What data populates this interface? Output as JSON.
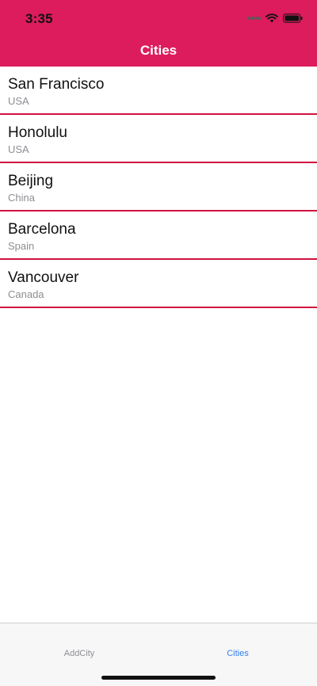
{
  "status_bar": {
    "time": "3:35",
    "icons": [
      "signal-dots-icon",
      "wifi-icon",
      "battery-icon"
    ]
  },
  "nav": {
    "title": "Cities"
  },
  "colors": {
    "header_bg": "#dc1c5c",
    "separator": "#d0133f",
    "active_tab": "#2f80ed",
    "inactive_tab": "#8e8e93"
  },
  "cities": [
    {
      "name": "San Francisco",
      "country": "USA"
    },
    {
      "name": "Honolulu",
      "country": "USA"
    },
    {
      "name": "Beijing",
      "country": "China"
    },
    {
      "name": "Barcelona",
      "country": "Spain"
    },
    {
      "name": "Vancouver",
      "country": "Canada"
    }
  ],
  "tabs": [
    {
      "label": "AddCity",
      "active": false
    },
    {
      "label": "Cities",
      "active": true
    }
  ]
}
